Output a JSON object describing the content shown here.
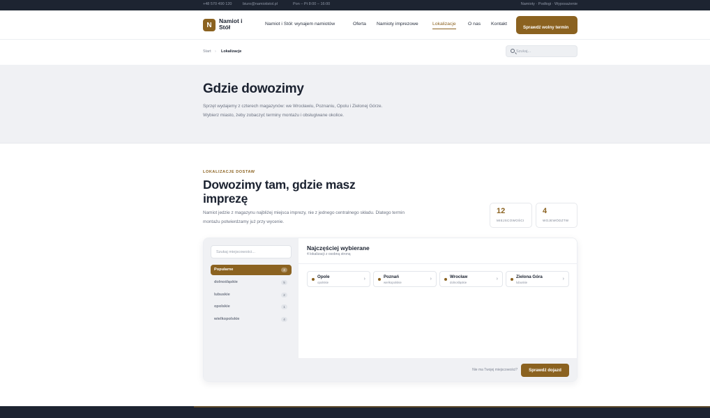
{
  "topbar": {
    "phone": "+48 570 490 120",
    "email": "biuro@namiotistol.pl",
    "hours": "Pon – Pt 8:00 – 16:00",
    "tagline": "Namioty · Podłogi · Wyposażenie"
  },
  "header": {
    "logo_letter": "N",
    "logo_text": "Namiot i Stół",
    "nav": [
      "Namiot i Stół: wynajem namiotów",
      "Oferta",
      "Namioty imprezowe",
      "Lokalizacje",
      "O nas",
      "Kontakt"
    ],
    "active_nav": "Lokalizacje",
    "cta_label": "Sprawdź wolny termin"
  },
  "breadcrumb": {
    "home": "Start",
    "separator": "›",
    "current": "Lokalizacje"
  },
  "search": {
    "placeholder": "Szukaj..."
  },
  "hero": {
    "title": "Gdzie dowozimy",
    "description": "Sprzęt wydajemy z czterech magazynów: we Wrocławiu, Poznaniu, Opolu i Zielonej Górze. Wybierz miasto, żeby zobaczyć terminy montażu i obsługiwane okolice."
  },
  "section": {
    "eyebrow": "LOKALIZACJE DOSTAW",
    "title": "Dowozimy tam, gdzie masz imprezę",
    "description": "Namiot jedzie z magazynu najbliżej miejsca imprezy, nie z jednego centralnego składu. Dlatego termin montażu potwierdzamy już przy wycenie."
  },
  "stats": [
    {
      "value": "12",
      "label": "MIEJSCOWOŚCI"
    },
    {
      "value": "4",
      "label": "WOJEWÓDZTW"
    }
  ],
  "finder": {
    "search_placeholder": "Szukaj miejscowości...",
    "regions": [
      {
        "name": "Popularne",
        "count": "4",
        "active": true
      },
      {
        "name": "dolnośląskie",
        "count": "5",
        "active": false
      },
      {
        "name": "lubuskie",
        "count": "2",
        "active": false
      },
      {
        "name": "opolskie",
        "count": "1",
        "active": false
      },
      {
        "name": "wielkopolskie",
        "count": "4",
        "active": false
      }
    ],
    "panel_title": "Najczęściej wybierane",
    "panel_subtitle": "4 lokalizacji z osobną stroną",
    "locations": [
      {
        "city": "Opole",
        "region": "opolskie"
      },
      {
        "city": "Poznań",
        "region": "wielkopolskie"
      },
      {
        "city": "Wrocław",
        "region": "dolnośląskie"
      },
      {
        "city": "Zielona Góra",
        "region": "lubuskie"
      }
    ],
    "footer_question": "Nie ma Twojej miejscowości?",
    "footer_button": "Sprawdź dojazd"
  },
  "colors": {
    "accent": "#8b6220",
    "dark": "#1d2431",
    "muted_bg": "#f0f1f4"
  }
}
